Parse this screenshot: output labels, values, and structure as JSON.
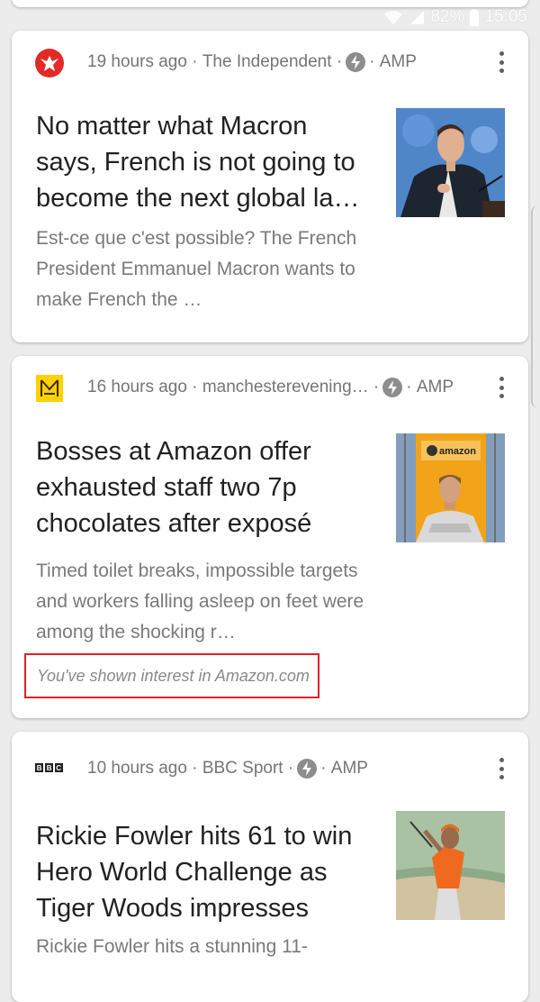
{
  "status_bar": {
    "battery": "82%",
    "time": "15:05"
  },
  "cards": [
    {
      "source_icon": "independent-eagle-logo",
      "time_ago": "19 hours ago",
      "source": "The Independent",
      "amp_label": "AMP",
      "headline": "No matter what Macron says, French is not going to become the next global la…",
      "snippet": "Est-ce que c'est possible? The French President Emmanuel Macron wants to make French the …"
    },
    {
      "source_icon": "manchester-evening-news-logo",
      "time_ago": "16 hours ago",
      "source": "manchesterevening…",
      "amp_label": "AMP",
      "headline": "Bosses at Amazon offer exhausted staff two 7p chocolates after exposé",
      "snippet": "Timed toilet breaks, impossible targets and workers falling asleep on feet were among the shocking r…",
      "interest": "You've shown interest in Amazon.com"
    },
    {
      "source_icon": "bbc-logo",
      "logo_text": "BBC",
      "time_ago": "10 hours ago",
      "source": "BBC Sport",
      "amp_label": "AMP",
      "headline": "Rickie Fowler hits 61 to win Hero World Challenge as Tiger Woods impresses",
      "snippet": "Rickie Fowler hits a stunning 11-"
    }
  ],
  "thumbnail_text": {
    "amazon_sign": "amazon"
  },
  "colors": {
    "background": "#ececec",
    "card": "#ffffff",
    "headline": "#212121",
    "meta": "#757575",
    "interest_border": "#e0212a",
    "amp_icon": "#8d8d8d"
  }
}
